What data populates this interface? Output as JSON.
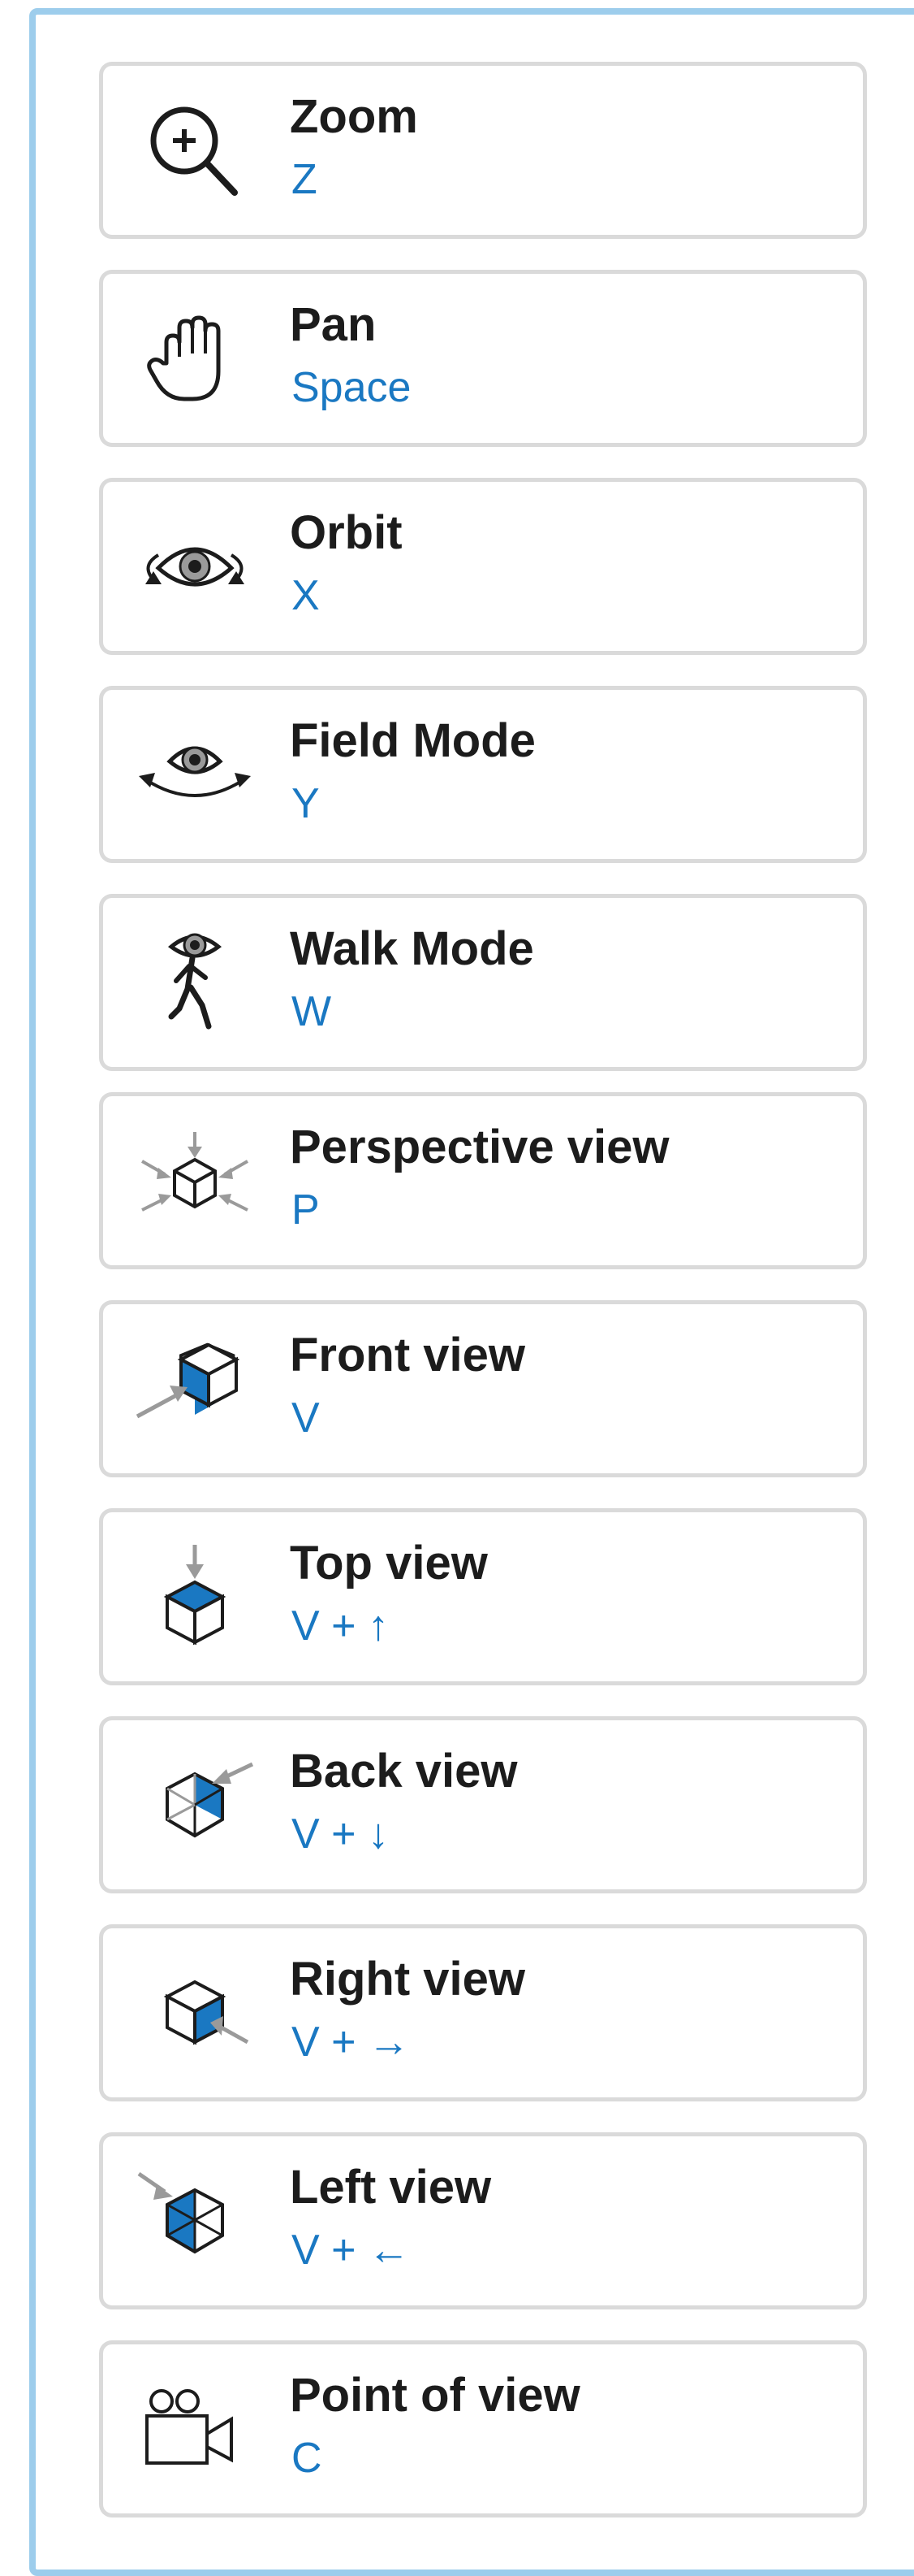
{
  "colors": {
    "accent": "#1a78c2",
    "panel_border": "#9dcdec",
    "card_border": "#dadada",
    "text": "#1c1c1c",
    "arrow": "#9a9a9a"
  },
  "tools": [
    {
      "label": "Zoom",
      "shortcut": "Z",
      "icon": "zoom-icon"
    },
    {
      "label": "Pan",
      "shortcut": "Space",
      "icon": "hand-pan-icon"
    },
    {
      "label": "Orbit",
      "shortcut": "X",
      "icon": "orbit-eye-icon"
    },
    {
      "label": "Field Mode",
      "shortcut": "Y",
      "icon": "field-eye-icon"
    },
    {
      "label": "Walk Mode",
      "shortcut": "W",
      "icon": "walk-eye-icon"
    },
    {
      "label": "Perspective view",
      "shortcut": "P",
      "icon": "perspective-cube-icon"
    },
    {
      "label": "Front view",
      "shortcut": "V",
      "icon": "front-cube-icon"
    },
    {
      "label": "Top view",
      "shortcut": "V + ↑",
      "icon": "top-cube-icon"
    },
    {
      "label": "Back view",
      "shortcut": "V + ↓",
      "icon": "back-cube-icon"
    },
    {
      "label": "Right view",
      "shortcut": "V + →",
      "icon": "right-cube-icon"
    },
    {
      "label": "Left view",
      "shortcut": "V + ←",
      "icon": "left-cube-icon"
    },
    {
      "label": "Point of view",
      "shortcut": "C",
      "icon": "camera-icon"
    }
  ]
}
